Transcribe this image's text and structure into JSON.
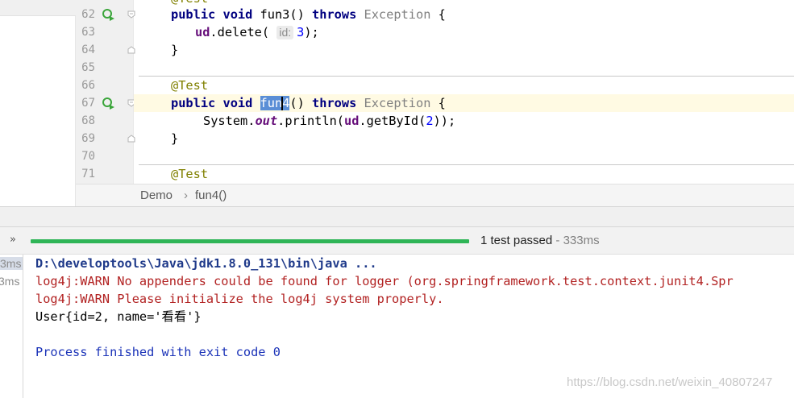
{
  "editor": {
    "lines": [
      {
        "num": "62",
        "has_run_icon": true
      },
      {
        "num": "63"
      },
      {
        "num": "64"
      },
      {
        "num": "65"
      },
      {
        "num": "66"
      },
      {
        "num": "67",
        "has_run_icon": true,
        "current": true
      },
      {
        "num": "68"
      },
      {
        "num": "69"
      },
      {
        "num": "70"
      },
      {
        "num": "71"
      }
    ],
    "code": {
      "l62": {
        "kw1": "public",
        "kw2": "void",
        "name": "fun3()",
        "kw3": "throws",
        "exc": "Exception",
        "brace": "{"
      },
      "l63": {
        "field": "ud",
        "call": ".delete(",
        "hint": "id:",
        "arg": "3",
        "end": ");"
      },
      "l64": {
        "brace": "}"
      },
      "l66": {
        "annotation": "@Test"
      },
      "l67": {
        "kw1": "public",
        "kw2": "void",
        "name_sel_a": "fun",
        "name_sel_b": "4",
        "name_rest": "()",
        "kw3": "throws",
        "exc": "Exception",
        "brace": "{"
      },
      "l68": {
        "a": "System.",
        "out": "out",
        "b": ".println(",
        "field": "ud",
        "c": ".getById(",
        "arg": "2",
        "end": "));"
      },
      "l69": {
        "brace": "}"
      },
      "l71": {
        "annotation": "@Test"
      }
    }
  },
  "breadcrumb": {
    "class_name": "Demo",
    "separator": "›",
    "method": "fun4()"
  },
  "run_bar": {
    "expand_icon": "»",
    "progress_fraction": 1.0,
    "status_main": "1 test passed",
    "status_sep": " - ",
    "status_time": "333ms",
    "progress_color": "#2fb557"
  },
  "console": {
    "times": [
      "3ms",
      "3ms"
    ],
    "lines": [
      {
        "kind": "cmd",
        "text": "D:\\developtools\\Java\\jdk1.8.0_131\\bin\\java ..."
      },
      {
        "kind": "warn",
        "text": "log4j:WARN No appenders could be found for logger (org.springframework.test.context.junit4.Spr"
      },
      {
        "kind": "warn",
        "text": "log4j:WARN Please initialize the log4j system properly."
      },
      {
        "kind": "plain",
        "text": "User{id=2, name='看看'}"
      },
      {
        "kind": "blank",
        "text": ""
      },
      {
        "kind": "blue",
        "text": "Process finished with exit code 0"
      }
    ]
  },
  "watermark": "https://blog.csdn.net/weixin_40807247"
}
